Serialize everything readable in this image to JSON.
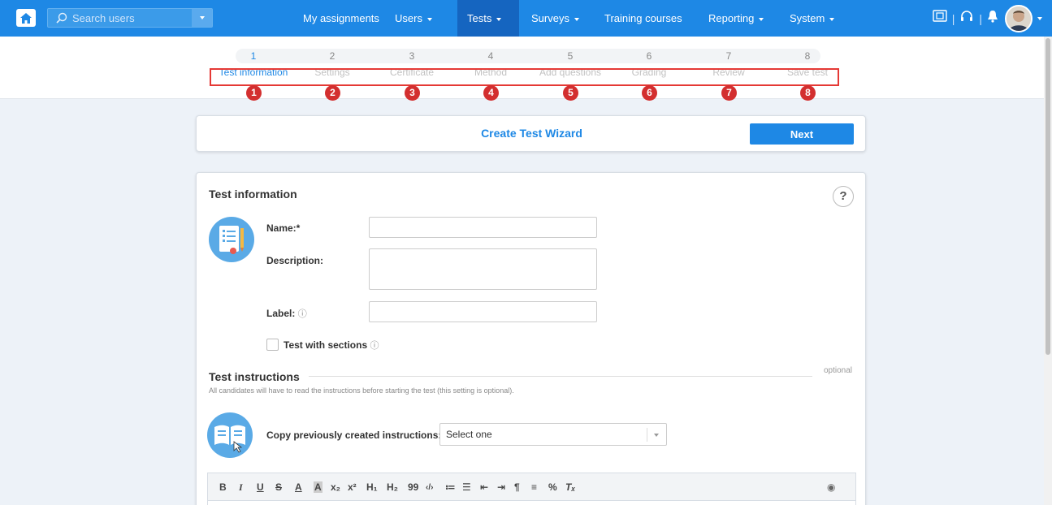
{
  "nav": {
    "search_placeholder": "Search users",
    "items": [
      {
        "label": "My assignments"
      },
      {
        "label": "Users"
      },
      {
        "label": "Tests"
      },
      {
        "label": "Surveys"
      },
      {
        "label": "Training courses"
      },
      {
        "label": "Reporting"
      },
      {
        "label": "System"
      }
    ],
    "accent_color": "#1e88e5",
    "active_color": "#1565c0"
  },
  "wizard": {
    "steps": [
      {
        "num": "1",
        "label": "Test information"
      },
      {
        "num": "2",
        "label": "Settings"
      },
      {
        "num": "3",
        "label": "Certificate"
      },
      {
        "num": "4",
        "label": "Method"
      },
      {
        "num": "5",
        "label": "Add questions"
      },
      {
        "num": "6",
        "label": "Grading"
      },
      {
        "num": "7",
        "label": "Review"
      },
      {
        "num": "8",
        "label": "Save test"
      }
    ],
    "title": "Create Test Wizard",
    "next_label": "Next"
  },
  "form": {
    "section_title": "Test information",
    "help": "?",
    "name_label": "Name:*",
    "description_label": "Description:",
    "label_label": "Label:",
    "sections_label": "Test with sections",
    "qicon": "?",
    "instructions_title": "Test instructions",
    "optional": "optional",
    "instructions_hint": "All candidates will have to read the instructions before starting the test (this setting is optional).",
    "copy_label": "Copy previously created instructions:",
    "copy_value": "Select one"
  },
  "toolbar": {
    "bold": "B",
    "italic": "I",
    "underline": "U",
    "strike": "S",
    "color": "A",
    "bg": "A",
    "sub": "x₂",
    "sup": "x²",
    "h1": "H₁",
    "h2": "H₂",
    "quote": "99",
    "code": "‹/›",
    "ol": "≔",
    "ul": "☰",
    "outdent": "⇤",
    "indent": "⇥",
    "rtl": "¶",
    "align": "≡",
    "link": "%",
    "clear": "Tₓ",
    "preview": "◉"
  }
}
